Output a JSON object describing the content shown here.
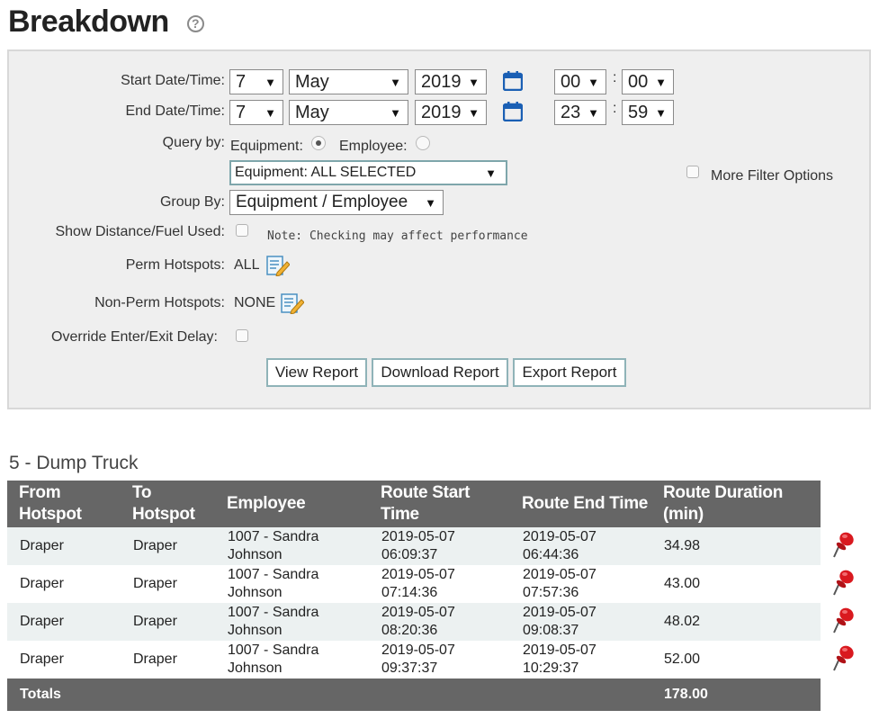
{
  "page": {
    "title": "Breakdown",
    "help_symbol": "?"
  },
  "filters": {
    "start": {
      "label": "Start Date/Time:",
      "day": "7",
      "month": "May",
      "year": "2019",
      "hour": "00",
      "minute": "00"
    },
    "end": {
      "label": "End Date/Time:",
      "day": "7",
      "month": "May",
      "year": "2019",
      "hour": "23",
      "minute": "59"
    },
    "time_separator": ":",
    "query_by": {
      "label": "Query by:",
      "equipment_label": "Equipment:",
      "employee_label": "Employee:",
      "selected": "Equipment",
      "dropdown_value": "Equipment: ALL SELECTED"
    },
    "more_filter_label": "More Filter Options",
    "group_by": {
      "label": "Group By:",
      "value": "Equipment / Employee"
    },
    "show_distance": {
      "label": "Show Distance/Fuel Used:",
      "note": "Note: Checking may affect performance"
    },
    "perm_hotspots": {
      "label": "Perm Hotspots:",
      "value": "ALL"
    },
    "non_perm_hotspots": {
      "label": "Non-Perm Hotspots:",
      "value": "NONE"
    },
    "override_delay": {
      "label": "Override Enter/Exit Delay:"
    },
    "buttons": {
      "view": "View Report",
      "download": "Download Report",
      "export": "Export Report"
    }
  },
  "report": {
    "section_title": "5 - Dump Truck",
    "columns": [
      "From\nHotspot",
      "To\nHotspot",
      "Employee",
      "Route Start\nTime",
      "Route End Time",
      "Route Duration\n(min)"
    ],
    "rows": [
      {
        "from": "Draper",
        "to": "Draper",
        "employee": "1007 - Sandra\nJohnson",
        "start": "2019-05-07\n06:09:37",
        "end": "2019-05-07\n06:44:36",
        "duration": "34.98"
      },
      {
        "from": "Draper",
        "to": "Draper",
        "employee": "1007 - Sandra\nJohnson",
        "start": "2019-05-07\n07:14:36",
        "end": "2019-05-07\n07:57:36",
        "duration": "43.00"
      },
      {
        "from": "Draper",
        "to": "Draper",
        "employee": "1007 - Sandra\nJohnson",
        "start": "2019-05-07\n08:20:36",
        "end": "2019-05-07\n09:08:37",
        "duration": "48.02"
      },
      {
        "from": "Draper",
        "to": "Draper",
        "employee": "1007 - Sandra\nJohnson",
        "start": "2019-05-07\n09:37:37",
        "end": "2019-05-07\n10:29:37",
        "duration": "52.00"
      }
    ],
    "totals": {
      "label": "Totals",
      "duration": "178.00"
    }
  },
  "colors": {
    "accent_blue": "#1a5fb4",
    "header_bg": "#666666",
    "pin_red": "#d9191f",
    "row_alt": "#ecf1f1"
  },
  "icons": {
    "calendar": "calendar-icon",
    "edit": "edit-list-icon",
    "pin": "pushpin-icon",
    "help": "help-icon"
  }
}
